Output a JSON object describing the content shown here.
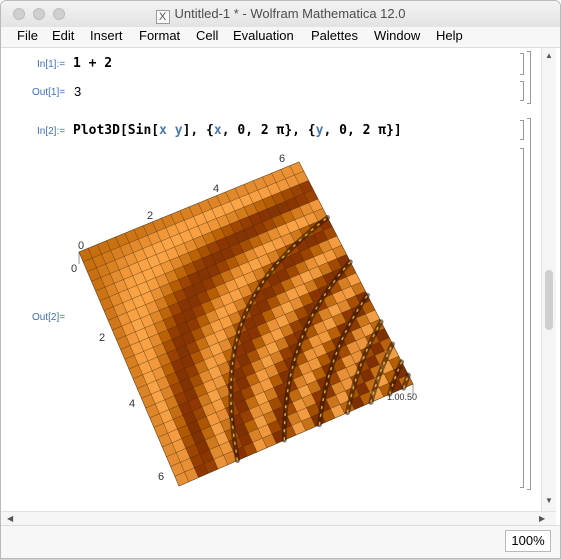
{
  "window": {
    "title": "Untitled-1 * - Wolfram Mathematica 12.0",
    "doc_icon": "X"
  },
  "menu": [
    "File",
    "Edit",
    "Insert",
    "Format",
    "Cell",
    "Evaluation",
    "Palettes",
    "Window",
    "Help"
  ],
  "cells": {
    "in1_label": "In[1]:=",
    "in1_text": "1 + 2",
    "out1_label": "Out[1]=",
    "out1_text": "3",
    "in2_label": "In[2]:=",
    "in2_text": {
      "p1": "Plot3D[Sin[",
      "x": "x",
      "space": " ",
      "y": "y",
      "p2": "], {",
      "x2": "x",
      "p3": ", 0, 2 π}, {",
      "y2": "y",
      "p4": ", 0, 2 π}]"
    },
    "out2_label": "Out[2]="
  },
  "plot": {
    "top_ticks": [
      "2",
      "4",
      "6"
    ],
    "left_ticks": [
      "0",
      "2",
      "4",
      "6"
    ],
    "corner_tick": "0",
    "z_ticks": "1.00.50",
    "surface_color": "#c97712",
    "mesh_color": "#3a2305"
  },
  "status": {
    "zoom": "100%"
  },
  "colors": {
    "label_blue": "#3d6fb0",
    "symbol_blue": "#4f7aa8"
  }
}
